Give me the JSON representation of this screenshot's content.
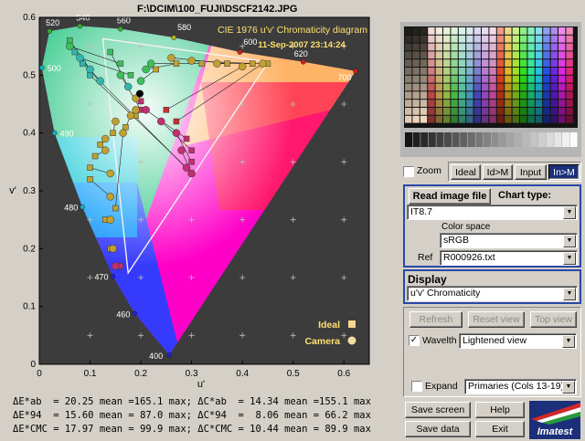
{
  "window_title": "F:\\DCIM\\100_FUJI\\DSCF2142.JPG",
  "colors": {
    "plot_bg": "#3c3c3c",
    "panel_bg": "#d4d0c8",
    "accent_blue": "#1c2f7a",
    "ideal_marker": "#f5d78c",
    "camera_marker": "#f0dca0"
  },
  "chart_data": {
    "type": "scatter",
    "title": "CIE 1976 u'v' Chromaticity diagram",
    "subtitle": "11-Sep-2007 23:14:24",
    "xlabel": "u'",
    "ylabel": "v'",
    "xlim": [
      0,
      0.65
    ],
    "ylim": [
      0,
      0.6
    ],
    "x_ticks": [
      "0",
      "0.1",
      "0.2",
      "0.3",
      "0.4",
      "0.5",
      "0.6"
    ],
    "y_ticks": [
      "0",
      "0.1",
      "0.2",
      "0.3",
      "0.4",
      "0.5",
      "0.6"
    ],
    "grid": true,
    "legend": [
      {
        "name": "Ideal",
        "marker": "square"
      },
      {
        "name": "Camera",
        "marker": "circle"
      }
    ],
    "legend_position": "bottom-right",
    "locus_labels": [
      {
        "nm": "400",
        "u": 0.256,
        "v": 0.016
      },
      {
        "nm": "460",
        "u": 0.188,
        "v": 0.088
      },
      {
        "nm": "470",
        "u": 0.145,
        "v": 0.152
      },
      {
        "nm": "480",
        "u": 0.085,
        "v": 0.272
      },
      {
        "nm": "490",
        "u": 0.03,
        "v": 0.4
      },
      {
        "nm": "500",
        "u": 0.005,
        "v": 0.513
      },
      {
        "nm": "520",
        "u": 0.02,
        "v": 0.576
      },
      {
        "nm": "540",
        "u": 0.08,
        "v": 0.585
      },
      {
        "nm": "560",
        "u": 0.16,
        "v": 0.58
      },
      {
        "nm": "580",
        "u": 0.265,
        "v": 0.565
      },
      {
        "nm": "600",
        "u": 0.395,
        "v": 0.54
      },
      {
        "nm": "620",
        "u": 0.52,
        "v": 0.523
      },
      {
        "nm": "700",
        "u": 0.623,
        "v": 0.507
      }
    ],
    "gamut_triangle": [
      {
        "u": 0.451,
        "v": 0.523
      },
      {
        "u": 0.125,
        "v": 0.563
      },
      {
        "u": 0.175,
        "v": 0.158
      }
    ],
    "white_point": {
      "u": 0.198,
      "v": 0.468
    },
    "series": [
      {
        "name": "Camera",
        "points": [
          {
            "u": 0.19,
            "v": 0.46
          },
          {
            "u": 0.19,
            "v": 0.44
          },
          {
            "u": 0.18,
            "v": 0.43
          },
          {
            "u": 0.15,
            "v": 0.42
          },
          {
            "u": 0.13,
            "v": 0.39
          },
          {
            "u": 0.13,
            "v": 0.37
          },
          {
            "u": 0.14,
            "v": 0.33
          },
          {
            "u": 0.14,
            "v": 0.29
          },
          {
            "u": 0.14,
            "v": 0.25
          },
          {
            "u": 0.145,
            "v": 0.2
          },
          {
            "u": 0.15,
            "v": 0.17
          },
          {
            "u": 0.165,
            "v": 0.4
          },
          {
            "u": 0.2,
            "v": 0.49
          },
          {
            "u": 0.21,
            "v": 0.51
          },
          {
            "u": 0.22,
            "v": 0.52
          },
          {
            "u": 0.26,
            "v": 0.53
          },
          {
            "u": 0.3,
            "v": 0.525
          },
          {
            "u": 0.35,
            "v": 0.52
          },
          {
            "u": 0.4,
            "v": 0.515
          },
          {
            "u": 0.44,
            "v": 0.52
          },
          {
            "u": 0.21,
            "v": 0.44
          },
          {
            "u": 0.24,
            "v": 0.42
          },
          {
            "u": 0.27,
            "v": 0.4
          },
          {
            "u": 0.28,
            "v": 0.37
          },
          {
            "u": 0.29,
            "v": 0.34
          },
          {
            "u": 0.3,
            "v": 0.33
          },
          {
            "u": 0.12,
            "v": 0.49
          },
          {
            "u": 0.1,
            "v": 0.51
          },
          {
            "u": 0.08,
            "v": 0.53
          },
          {
            "u": 0.06,
            "v": 0.55
          },
          {
            "u": 0.175,
            "v": 0.48
          },
          {
            "u": 0.16,
            "v": 0.5
          }
        ]
      },
      {
        "name": "Ideal",
        "points": [
          {
            "u": 0.2,
            "v": 0.455
          },
          {
            "u": 0.19,
            "v": 0.43
          },
          {
            "u": 0.17,
            "v": 0.41
          },
          {
            "u": 0.145,
            "v": 0.4
          },
          {
            "u": 0.12,
            "v": 0.38
          },
          {
            "u": 0.11,
            "v": 0.36
          },
          {
            "u": 0.1,
            "v": 0.34
          },
          {
            "u": 0.1,
            "v": 0.32
          },
          {
            "u": 0.13,
            "v": 0.25
          },
          {
            "u": 0.14,
            "v": 0.2
          },
          {
            "u": 0.16,
            "v": 0.17
          },
          {
            "u": 0.15,
            "v": 0.27
          },
          {
            "u": 0.23,
            "v": 0.51
          },
          {
            "u": 0.27,
            "v": 0.52
          },
          {
            "u": 0.32,
            "v": 0.52
          },
          {
            "u": 0.37,
            "v": 0.52
          },
          {
            "u": 0.42,
            "v": 0.52
          },
          {
            "u": 0.45,
            "v": 0.52
          },
          {
            "u": 0.25,
            "v": 0.44
          },
          {
            "u": 0.27,
            "v": 0.42
          },
          {
            "u": 0.29,
            "v": 0.39
          },
          {
            "u": 0.3,
            "v": 0.37
          },
          {
            "u": 0.3,
            "v": 0.35
          },
          {
            "u": 0.3,
            "v": 0.33
          },
          {
            "u": 0.1,
            "v": 0.5
          },
          {
            "u": 0.085,
            "v": 0.52
          },
          {
            "u": 0.07,
            "v": 0.54
          },
          {
            "u": 0.06,
            "v": 0.56
          },
          {
            "u": 0.18,
            "v": 0.5
          },
          {
            "u": 0.16,
            "v": 0.52
          },
          {
            "u": 0.14,
            "v": 0.54
          },
          {
            "u": 0.2,
            "v": 0.44
          }
        ]
      }
    ]
  },
  "stats": [
    "ΔE*ab  = 20.25 mean =165.1 max; ΔC*ab  = 14.34 mean =155.1 max",
    "ΔE*94  = 15.60 mean = 87.0 max; ΔC*94  =  8.06 mean = 66.2 max",
    "ΔE*CMC = 17.97 mean = 99.9 max; ΔC*CMC = 10.44 mean = 89.9 max"
  ],
  "controls": {
    "zoom_label": "Zoom",
    "zoom_checked": false,
    "view_tabs": [
      "Ideal",
      "Id>M",
      "Input",
      "In>M"
    ],
    "active_tab": "In>M",
    "read_image_file": "Read image file",
    "chart_type_label": "Chart type:",
    "chart_type_value": "IT8.7",
    "color_space_label": "Color space",
    "color_space_value": "sRGB",
    "ref_label": "Ref",
    "ref_value": "R000926.txt",
    "display_label": "Display",
    "display_value": "u'v' Chromaticity",
    "refresh": "Refresh",
    "reset_view": "Reset view",
    "top_view": "Top view",
    "wavelth_label": "Wavelth",
    "wavelth_checked": true,
    "wavelth_option": "Lightened view",
    "expand_label": "Expand",
    "expand_checked": false,
    "expand_option": "Primaries (Cols 13-19)",
    "save_screen": "Save screen",
    "help": "Help",
    "save_data": "Save data",
    "exit": "Exit",
    "logo_text": "Imatest"
  }
}
